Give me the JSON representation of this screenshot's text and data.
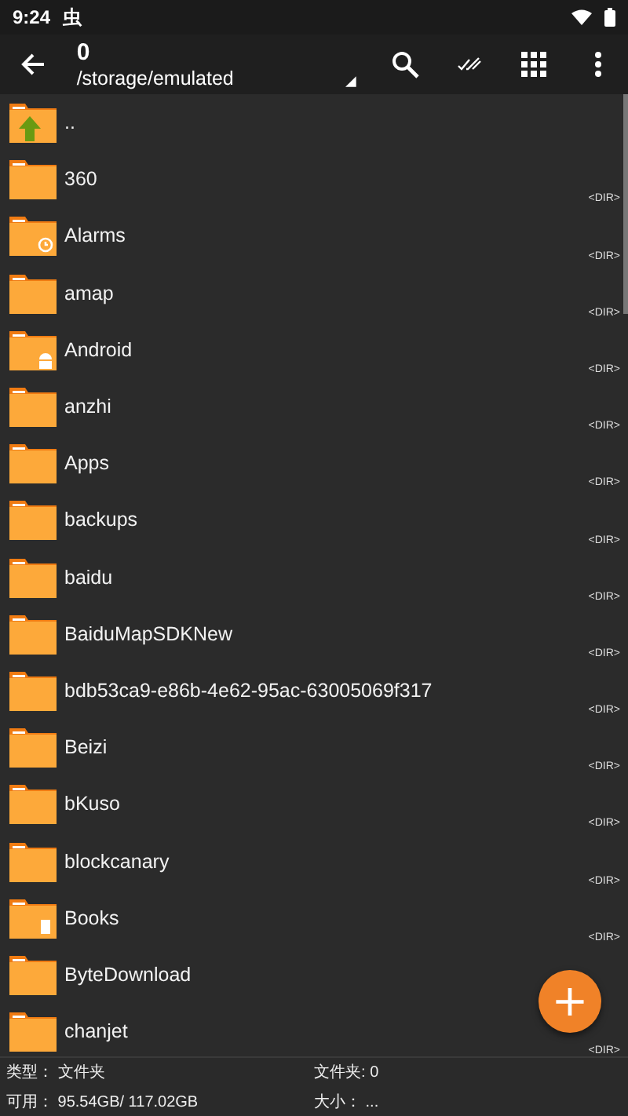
{
  "status_bar": {
    "time": "9:24",
    "notification": "虫"
  },
  "toolbar": {
    "title": "0",
    "path": "/storage/emulated"
  },
  "files": [
    {
      "name": "..",
      "kind": "up"
    },
    {
      "name": "360",
      "kind": "plain",
      "tag": "<DIR>"
    },
    {
      "name": "Alarms",
      "kind": "alarm",
      "tag": "<DIR>"
    },
    {
      "name": "amap",
      "kind": "plain",
      "tag": "<DIR>"
    },
    {
      "name": "Android",
      "kind": "android",
      "tag": "<DIR>"
    },
    {
      "name": "anzhi",
      "kind": "plain",
      "tag": "<DIR>"
    },
    {
      "name": "Apps",
      "kind": "plain",
      "tag": "<DIR>"
    },
    {
      "name": "backups",
      "kind": "plain",
      "tag": "<DIR>"
    },
    {
      "name": "baidu",
      "kind": "plain",
      "tag": "<DIR>"
    },
    {
      "name": "BaiduMapSDKNew",
      "kind": "plain",
      "tag": "<DIR>"
    },
    {
      "name": "bdb53ca9-e86b-4e62-95ac-63005069f317",
      "kind": "plain",
      "tag": "<DIR>"
    },
    {
      "name": "Beizi",
      "kind": "plain",
      "tag": "<DIR>"
    },
    {
      "name": "bKuso",
      "kind": "plain",
      "tag": "<DIR>"
    },
    {
      "name": "blockcanary",
      "kind": "plain",
      "tag": "<DIR>"
    },
    {
      "name": "Books",
      "kind": "book",
      "tag": "<DIR>"
    },
    {
      "name": "ByteDownload",
      "kind": "plain"
    },
    {
      "name": "chanjet",
      "kind": "plain",
      "tag": "<DIR>"
    }
  ],
  "footer": [
    {
      "label": "类型：",
      "value": "文件夹"
    },
    {
      "label": "文件夹:",
      "value": "0"
    },
    {
      "label": "可用：",
      "value": "95.54GB/ 117.02GB"
    },
    {
      "label": "大小：",
      "value": "..."
    }
  ],
  "fab": "+"
}
